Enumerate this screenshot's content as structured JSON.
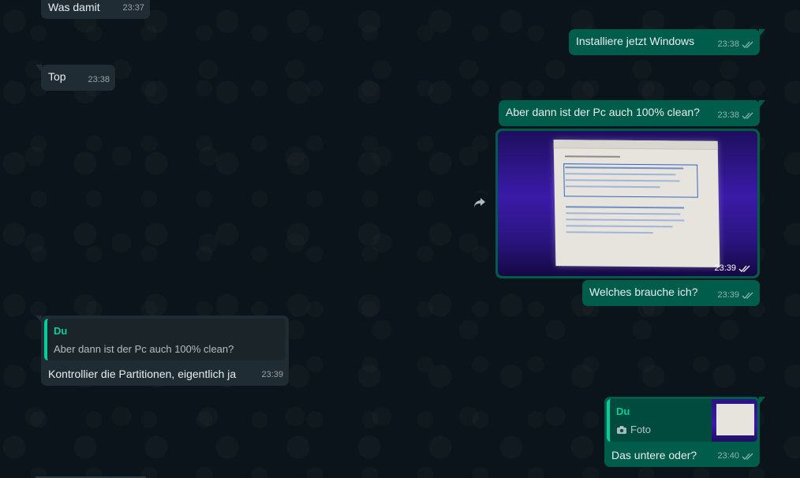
{
  "colors": {
    "background": "#0b141a",
    "incoming_bubble": "#202c33",
    "outgoing_bubble": "#005c4b",
    "quote_accent": "#06cf9c",
    "text": "#e9edef"
  },
  "messages": {
    "m1": {
      "text": "Was damit",
      "time": "23:37"
    },
    "m2": {
      "text": "Installiere jetzt Windows",
      "time": "23:38"
    },
    "m3": {
      "text": "Top",
      "time": "23:38"
    },
    "m4": {
      "text": "Aber dann ist der Pc auch 100% clean?",
      "time": "23:38"
    },
    "m5": {
      "time": "23:39"
    },
    "m6": {
      "text": "Welches brauche ich?",
      "time": "23:39"
    },
    "m7": {
      "quote_author": "Du",
      "quote_text": "Aber dann ist der Pc auch 100% clean?",
      "text": "Kontrollier die Partitionen, eigentlich ja",
      "time": "23:39"
    },
    "m8": {
      "quote_author": "Du",
      "quote_media_label": "Foto",
      "text": "Das untere oder?",
      "time": "23:40"
    }
  },
  "icons": {
    "forward": "forward-arrow-icon",
    "read_receipt": "double-check-icon",
    "camera": "camera-icon"
  }
}
